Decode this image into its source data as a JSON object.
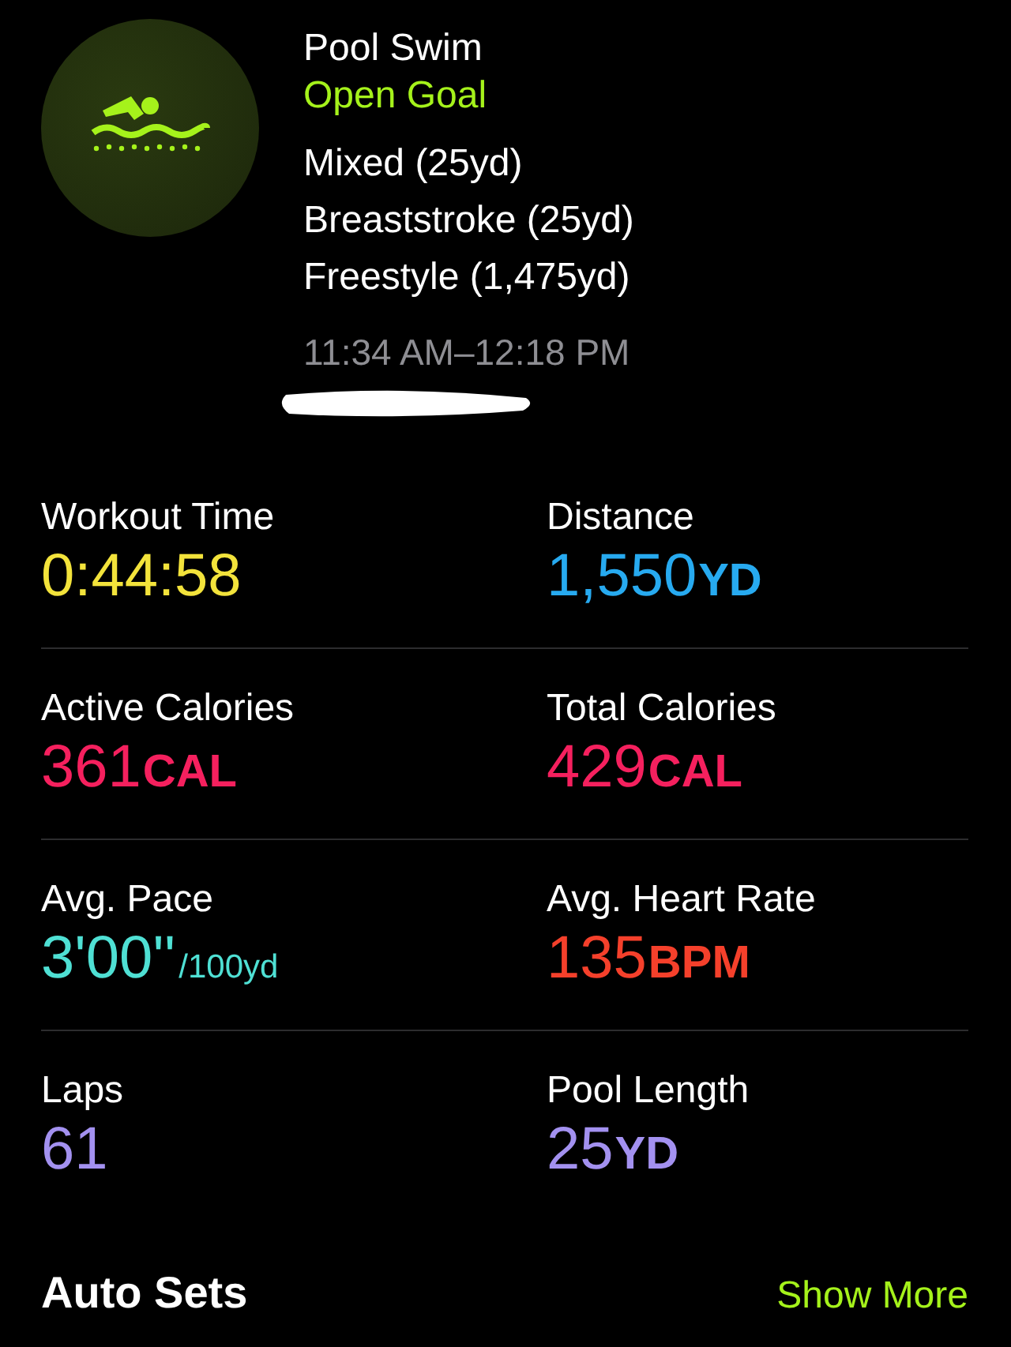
{
  "workout": {
    "title": "Pool Swim",
    "goal": "Open Goal",
    "segments": [
      "Mixed (25yd)",
      "Breaststroke (25yd)",
      "Freestyle (1,475yd)"
    ],
    "time_range": "11:34 AM–12:18 PM"
  },
  "metrics": [
    {
      "label": "Workout Time",
      "value": "0:44:58",
      "kind": "plain",
      "color": "#f3e33b"
    },
    {
      "label": "Distance",
      "value": "1,550",
      "unit": "YD",
      "kind": "caps",
      "color": "#27aaf0"
    },
    {
      "label": "Active Calories",
      "value": "361",
      "unit": "CAL",
      "kind": "caps",
      "color": "#f5205e"
    },
    {
      "label": "Total Calories",
      "value": "429",
      "unit": "CAL",
      "kind": "caps",
      "color": "#f5205e"
    },
    {
      "label": "Avg. Pace",
      "value": "3'00''",
      "unit": "/100yd",
      "kind": "small",
      "color": "#4fe0d4"
    },
    {
      "label": "Avg. Heart Rate",
      "value": "135",
      "unit": "BPM",
      "kind": "caps",
      "color": "#f5402b"
    },
    {
      "label": "Laps",
      "value": "61",
      "kind": "plain",
      "color": "#a391f0"
    },
    {
      "label": "Pool Length",
      "value": "25",
      "unit": "YD",
      "kind": "caps",
      "color": "#a391f0"
    }
  ],
  "auto_sets": {
    "title": "Auto Sets",
    "link": "Show More"
  }
}
